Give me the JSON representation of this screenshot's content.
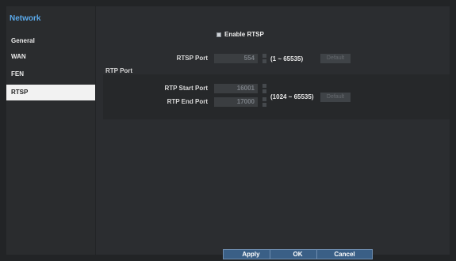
{
  "sidebar": {
    "title": "Network",
    "items": [
      {
        "label": "General"
      },
      {
        "label": "WAN"
      },
      {
        "label": "FEN"
      },
      {
        "label": "RTSP"
      }
    ]
  },
  "rtsp": {
    "enable_label": "Enable RTSP",
    "port_label": "RTSP Port",
    "port_value": "554",
    "port_range": "(1 ~ 65535)",
    "default_label": "Default"
  },
  "rtp": {
    "section_label": "RTP Port",
    "start_label": "RTP Start Port",
    "start_value": "16001",
    "end_label": "RTP End Port",
    "end_value": "17000",
    "range": "(1024 ~ 65535)",
    "default_label": "Default"
  },
  "buttons": {
    "apply": "Apply",
    "ok": "OK",
    "cancel": "Cancel"
  }
}
